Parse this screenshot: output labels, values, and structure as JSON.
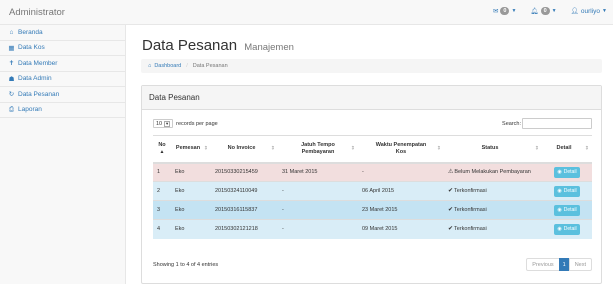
{
  "navbar": {
    "brand": "Administrator",
    "messages_count": "0",
    "alerts_count": "0",
    "user_name": "ourliyo"
  },
  "sidebar": {
    "items": [
      {
        "label": "Beranda",
        "icon": "dashboard-icon"
      },
      {
        "label": "Data Kos",
        "icon": "table-icon"
      },
      {
        "label": "Data Member",
        "icon": "user-icon"
      },
      {
        "label": "Data Admin",
        "icon": "users-icon"
      },
      {
        "label": "Data Pesanan",
        "icon": "refresh-icon"
      },
      {
        "label": "Laporan",
        "icon": "print-icon"
      }
    ]
  },
  "page": {
    "title": "Data Pesanan",
    "subtitle": "Manajemen",
    "breadcrumb": {
      "home": "Dashboard",
      "current": "Data Pesanan"
    }
  },
  "panel": {
    "heading": "Data Pesanan",
    "length_value": "10",
    "length_suffix": "records per page",
    "search_label": "Search:",
    "columns": [
      "No",
      "Pemesan",
      "No Invoice",
      "Jatuh Tempo Pembayaran",
      "Waktu Penempatan Kos",
      "Status",
      "Detail"
    ],
    "rows": [
      {
        "no": "1",
        "pemesan": "Eko",
        "invoice": "20150330215459",
        "jatuh_tempo": "31 Maret 2015",
        "waktu": "-",
        "status": "Belum Melakukan Pembayaran",
        "detail": "Detail"
      },
      {
        "no": "2",
        "pemesan": "Eko",
        "invoice": "20150324110049",
        "jatuh_tempo": "-",
        "waktu": "06 April 2015",
        "status": "Terkonfirmasi",
        "detail": "Detail"
      },
      {
        "no": "3",
        "pemesan": "Eko",
        "invoice": "20150316115837",
        "jatuh_tempo": "-",
        "waktu": "23 Maret 2015",
        "status": "Terkonfirmasi",
        "detail": "Detail"
      },
      {
        "no": "4",
        "pemesan": "Eko",
        "invoice": "20150302121218",
        "jatuh_tempo": "-",
        "waktu": "09 Maret 2015",
        "status": "Terkonfirmasi",
        "detail": "Detail"
      }
    ],
    "info": "Showing 1 to 4 of 4 entries",
    "pagination": {
      "previous": "Previous",
      "page": "1",
      "next": "Next"
    }
  },
  "colors": {
    "link": "#337ab7",
    "danger_row": "#f2dede",
    "info_row": "#d9edf7",
    "detail_button": "#5bc0de"
  }
}
